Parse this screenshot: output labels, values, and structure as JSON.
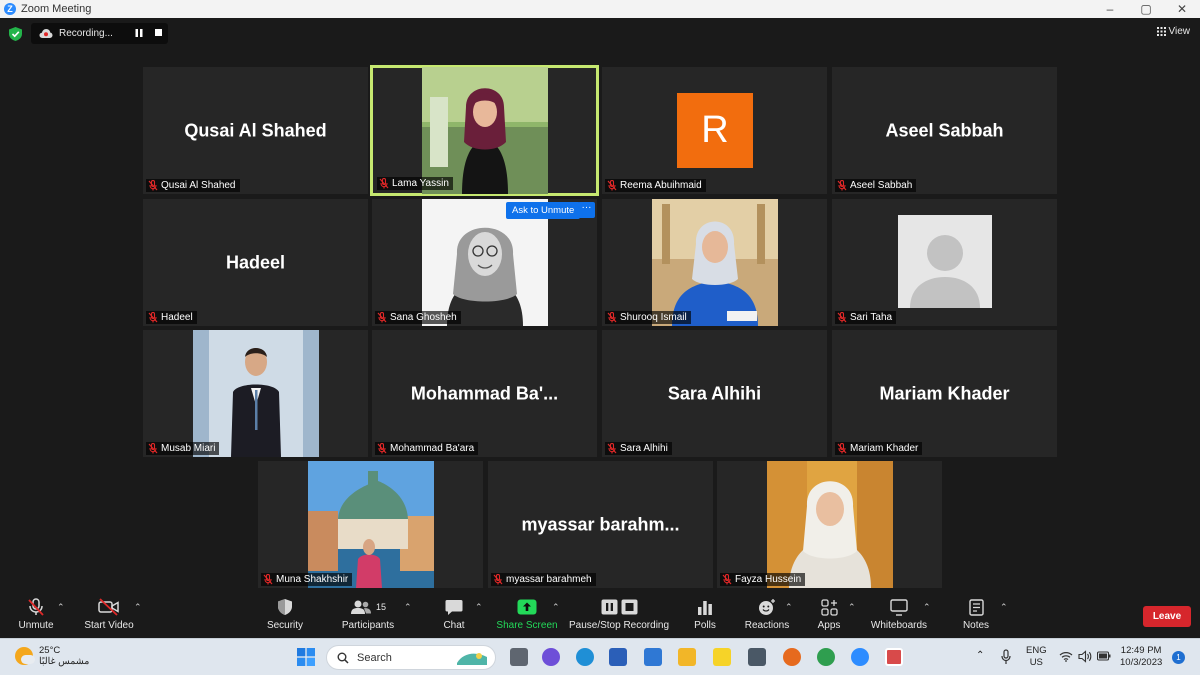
{
  "window": {
    "title": "Zoom Meeting",
    "controls": [
      "–",
      "▢",
      "✕"
    ]
  },
  "recording": {
    "label": "Recording..."
  },
  "view_label": "View",
  "tiles": [
    {
      "name": "Qusai Al Shahed",
      "big": "Qusai Al Shahed"
    },
    {
      "name": "Lama Yassin"
    },
    {
      "name": "Reema Abuihmaid",
      "avatar_letter": "R"
    },
    {
      "name": "Aseel Sabbah",
      "big": "Aseel Sabbah"
    },
    {
      "name": "Hadeel",
      "big": "Hadeel"
    },
    {
      "name": "Sana Ghosheh",
      "ask_to_unmute": "Ask to Unmute",
      "more": "···"
    },
    {
      "name": "Shurooq Ismail"
    },
    {
      "name": "Sari Taha"
    },
    {
      "name": "Musab Miari"
    },
    {
      "name": "Mohammad Ba'ara",
      "big": "Mohammad  Ba'..."
    },
    {
      "name": "Sara Alhihi",
      "big": "Sara Alhihi"
    },
    {
      "name": "Mariam Khader",
      "big": "Mariam Khader"
    },
    {
      "name": "Muna Shakhshir"
    },
    {
      "name": "myassar barahmeh",
      "big": "myassar  barahm..."
    },
    {
      "name": "Fayza Hussein"
    }
  ],
  "toolbar": {
    "unmute": "Unmute",
    "start_video": "Start Video",
    "security": "Security",
    "participants": "Participants",
    "participants_count": "15",
    "chat": "Chat",
    "share_screen": "Share Screen",
    "pause_stop_recording": "Pause/Stop Recording",
    "polls": "Polls",
    "reactions": "Reactions",
    "apps": "Apps",
    "whiteboards": "Whiteboards",
    "notes": "Notes",
    "leave": "Leave"
  },
  "taskbar": {
    "temperature": "25°C",
    "weather_text": "مشمس غالبًا",
    "search_placeholder": "Search",
    "language": "ENG",
    "region": "US",
    "time": "12:49 PM",
    "date": "10/3/2023",
    "notification_count": "1"
  },
  "colors": {
    "active_speaker": "#c6e870",
    "share_screen": "#23d959",
    "leave": "#d6262c",
    "avatar_orange": "#f26d0e",
    "muted_red": "#e02828"
  }
}
